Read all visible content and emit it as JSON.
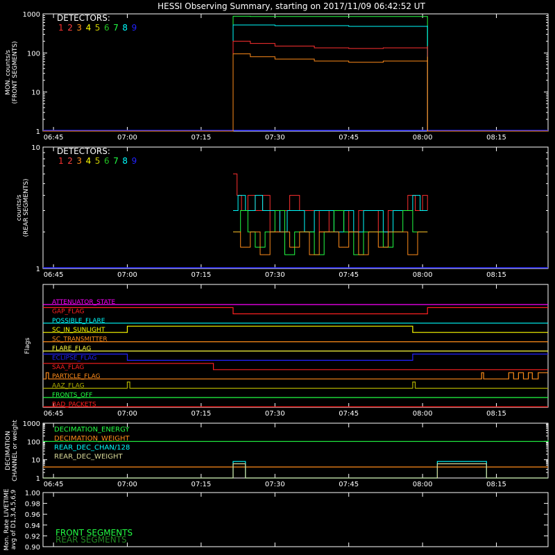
{
  "title": "HESSI Observing Summary, starting on 2017/11/09 06:42:52 UT",
  "colors": {
    "det1": "#ff3030",
    "det2": "#ff4040",
    "det3": "#ff8c1a",
    "det4": "#ffff00",
    "det5": "#c8c800",
    "det6": "#22c022",
    "det7": "#22ff44",
    "det8": "#00ffff",
    "det9": "#2222ff",
    "axis": "#ffffff"
  },
  "time_axis": {
    "ticks": [
      "06:45",
      "07:00",
      "07:15",
      "07:30",
      "07:45",
      "08:00",
      "08:15"
    ],
    "tick_minutes": [
      405,
      420,
      435,
      450,
      465,
      480,
      495
    ],
    "range_minutes": [
      402.87,
      505.5
    ]
  },
  "chart_data": [
    {
      "type": "line",
      "panel": "front_rates",
      "ylabel": "MON. counts/s",
      "ylabel2": "(FRONT SEGMENTS)",
      "yscale": "log",
      "ylim": [
        1,
        1000
      ],
      "yticks": [
        "1",
        "10",
        "100",
        "1000"
      ],
      "legend_title": "DETECTORS:",
      "legend_digits": [
        "1",
        "2",
        "3",
        "4",
        "5",
        "6",
        "7",
        "8",
        "9"
      ],
      "series": [
        {
          "color": "green",
          "x": [
            402.87,
            441.5,
            441.5,
            445,
            465,
            481,
            481,
            505.5
          ],
          "y": [
            1,
            1,
            870,
            860,
            860,
            880,
            1,
            1
          ]
        },
        {
          "color": "cyan",
          "x": [
            402.87,
            441.5,
            441.5,
            450,
            465,
            481,
            481,
            505.5
          ],
          "y": [
            1,
            1,
            520,
            500,
            480,
            500,
            1,
            1
          ]
        },
        {
          "color": "red",
          "x": [
            402.87,
            441.5,
            441.5,
            445,
            450,
            458,
            465,
            472,
            481,
            481,
            505.5
          ],
          "y": [
            1,
            1,
            200,
            175,
            150,
            135,
            130,
            135,
            150,
            1,
            1
          ]
        },
        {
          "color": "orange",
          "x": [
            402.87,
            441.5,
            441.5,
            445,
            450,
            458,
            465,
            472,
            481,
            481,
            505.5
          ],
          "y": [
            1,
            1,
            95,
            80,
            70,
            62,
            58,
            62,
            80,
            1,
            1
          ]
        }
      ]
    },
    {
      "type": "line",
      "panel": "rear_rates",
      "ylabel": "counts/s",
      "ylabel2": "(REAR SEGMENTS)",
      "yscale": "log",
      "ylim": [
        1,
        10
      ],
      "yticks": [
        "1",
        "10"
      ],
      "legend_title": "DETECTORS:",
      "legend_digits": [
        "1",
        "2",
        "3",
        "4",
        "5",
        "6",
        "7",
        "8",
        "9"
      ],
      "series": [
        {
          "color": "red",
          "x": [
            441.5,
            442.3,
            443.2,
            444.5,
            446,
            447.5,
            449,
            451,
            453,
            455,
            457,
            459,
            461,
            463,
            465,
            467,
            469,
            471,
            473,
            475,
            477,
            478.5,
            480,
            481
          ],
          "y": [
            6,
            4,
            3,
            4,
            3,
            4,
            2,
            3,
            4,
            3,
            3,
            2,
            3,
            3,
            2,
            3,
            3,
            2,
            3,
            3,
            4,
            3,
            4,
            3
          ]
        },
        {
          "color": "cyan",
          "x": [
            441.5,
            442.5,
            444,
            446,
            447.5,
            449.5,
            451,
            452.5,
            454,
            456,
            458,
            460,
            462,
            464,
            466,
            468,
            470,
            472,
            474,
            476,
            478,
            479.5,
            481
          ],
          "y": [
            3,
            4,
            3,
            4,
            3,
            3,
            2,
            3,
            3,
            2,
            3,
            3,
            2,
            3,
            2,
            3,
            3,
            2,
            3,
            3,
            4,
            3,
            3
          ]
        },
        {
          "color": "green",
          "x": [
            441.5,
            443,
            444.5,
            446,
            448,
            450,
            452,
            454,
            456,
            458,
            460,
            462,
            464,
            466,
            468,
            470,
            472,
            474,
            476,
            478,
            480,
            481
          ],
          "y": [
            2,
            3,
            2,
            1.5,
            2,
            3,
            1.3,
            2,
            2,
            1.3,
            2,
            3,
            2,
            1.3,
            2,
            2,
            1.5,
            2,
            3,
            2,
            2,
            2
          ]
        },
        {
          "color": "orange",
          "x": [
            441.5,
            443,
            445,
            447,
            449,
            451,
            453,
            455,
            457,
            459,
            461,
            463,
            465,
            467,
            469,
            471,
            473,
            475,
            477,
            479,
            481
          ],
          "y": [
            2,
            1.5,
            2,
            1.3,
            2,
            2,
            1.5,
            2,
            1.3,
            2,
            2,
            1.5,
            2,
            1.3,
            2,
            1.5,
            2,
            2,
            1.3,
            2,
            2
          ]
        }
      ]
    },
    {
      "type": "line",
      "panel": "flags",
      "ylabel": "Flags",
      "flags": [
        {
          "label": "ATTENUATOR_STATE",
          "color": "#ff00ff",
          "x": [
            402.87,
            505.5
          ],
          "high": [
            0,
            0
          ]
        },
        {
          "label": "GAP_FLAG",
          "color": "#ff2020",
          "x": [
            402.87,
            441.5,
            441.5,
            481,
            481,
            505.5
          ],
          "high": [
            1,
            1,
            0,
            0,
            1,
            1
          ]
        },
        {
          "label": "POSSIBLE_FLARE",
          "color": "#00ffff",
          "x": [
            402.87,
            505.5
          ],
          "high": [
            0,
            0
          ]
        },
        {
          "label": "SC_IN_SUNLIGHT",
          "color": "#ffff00",
          "x": [
            402.87,
            420,
            420,
            478,
            478,
            505.5
          ],
          "high": [
            0,
            0,
            1,
            1,
            0,
            0
          ]
        },
        {
          "label": "SC_TRANSMITTER",
          "color": "#ff8c1a",
          "x": [
            402.87,
            505.5
          ],
          "high": [
            0,
            0
          ]
        },
        {
          "label": "FLARE_FLAG",
          "color": "#ffff40",
          "x": [
            402.87,
            505.5
          ],
          "high": [
            0,
            0
          ]
        },
        {
          "label": "ECLIPSE_FLAG",
          "color": "#2222ff",
          "x": [
            402.87,
            420,
            420,
            478,
            478,
            505.5
          ],
          "high": [
            1,
            1,
            0,
            0,
            1,
            1
          ]
        },
        {
          "label": "SAA_FLAG",
          "color": "#ff2020",
          "x": [
            402.87,
            437.5,
            437.5,
            505.5
          ],
          "high": [
            1,
            1,
            0,
            0
          ]
        },
        {
          "label": "PARTICLE_FLAG",
          "color": "#ff8c1a",
          "x": [
            402.87,
            403.5,
            403.5,
            404,
            404,
            492,
            492,
            492.4,
            492.4,
            497.5,
            497.5,
            498.5,
            498.5,
            499.5,
            499.5,
            500.5,
            500.5,
            501.5,
            501.5,
            502.3,
            502.3,
            503.5,
            503.5,
            505.5
          ],
          "high": [
            0,
            0,
            1,
            1,
            0,
            0,
            1,
            1,
            0,
            0,
            1,
            1,
            0,
            0,
            1,
            1,
            0,
            0,
            1,
            1,
            0,
            0,
            1,
            1
          ]
        },
        {
          "label": "AAZ_FLAG",
          "color": "#b0b000",
          "x": [
            402.87,
            420,
            420,
            420.5,
            420.5,
            478,
            478,
            478.5,
            478.5,
            505.5
          ],
          "high": [
            0,
            0,
            1,
            1,
            0,
            0,
            1,
            1,
            0,
            0
          ]
        },
        {
          "label": "FRONTS_OFF",
          "color": "#22ff44",
          "x": [
            402.87,
            505.5
          ],
          "high": [
            0,
            0
          ]
        },
        {
          "label": "BAD_PACKETS",
          "color": "#ff2020",
          "x": [
            402.87,
            505.5
          ],
          "high": [
            0,
            0
          ]
        }
      ]
    },
    {
      "type": "line",
      "panel": "decimation",
      "ylabel": "DECIMATION",
      "ylabel2": "CHANNEL or weight",
      "yscale": "log",
      "ylim": [
        1,
        1000
      ],
      "yticks": [
        "1",
        "10",
        "100",
        "1000"
      ],
      "legend": [
        {
          "label": "DECIMATION_ENERGY",
          "color": "#22ff44"
        },
        {
          "label": "DECIMATION_WEIGHT",
          "color": "#ff8c1a"
        },
        {
          "label": "REAR_DEC_CHAN/128",
          "color": "#00ffff"
        },
        {
          "label": "REAR_DEC_WEIGHT",
          "color": "#d8d898"
        }
      ],
      "series": [
        {
          "color": "green",
          "x": [
            402.87,
            504,
            505.5
          ],
          "y": [
            100,
            100,
            120
          ]
        },
        {
          "color": "orange",
          "x": [
            402.87,
            505.5
          ],
          "y": [
            4,
            4
          ]
        },
        {
          "color": "cyan",
          "x": [
            402.87,
            441.5,
            441.5,
            444,
            444,
            483,
            483,
            493,
            493,
            505.5
          ],
          "y": [
            1,
            1,
            8,
            8,
            1,
            1,
            8,
            8,
            1,
            1
          ]
        },
        {
          "color": "khaki",
          "x": [
            402.87,
            441.5,
            441.5,
            444,
            444,
            483,
            483,
            493,
            493,
            505.5
          ],
          "y": [
            1,
            1,
            6,
            6,
            1,
            1,
            6,
            6,
            1,
            1
          ]
        }
      ]
    },
    {
      "type": "line",
      "panel": "livetime",
      "ylabel": "Mon. Rate LIVETIME",
      "ylabel2": "avg of D1,3,4,5,6,9",
      "ylim": [
        0.9,
        1.0
      ],
      "yticks": [
        "0.90",
        "0.92",
        "0.94",
        "0.96",
        "0.98",
        "1.00"
      ],
      "legend": [
        {
          "label": "FRONT SEGMENTS",
          "color": "#22ff44"
        },
        {
          "label": "REAR SEGMENTS",
          "color": "#228822"
        }
      ],
      "series": []
    }
  ]
}
